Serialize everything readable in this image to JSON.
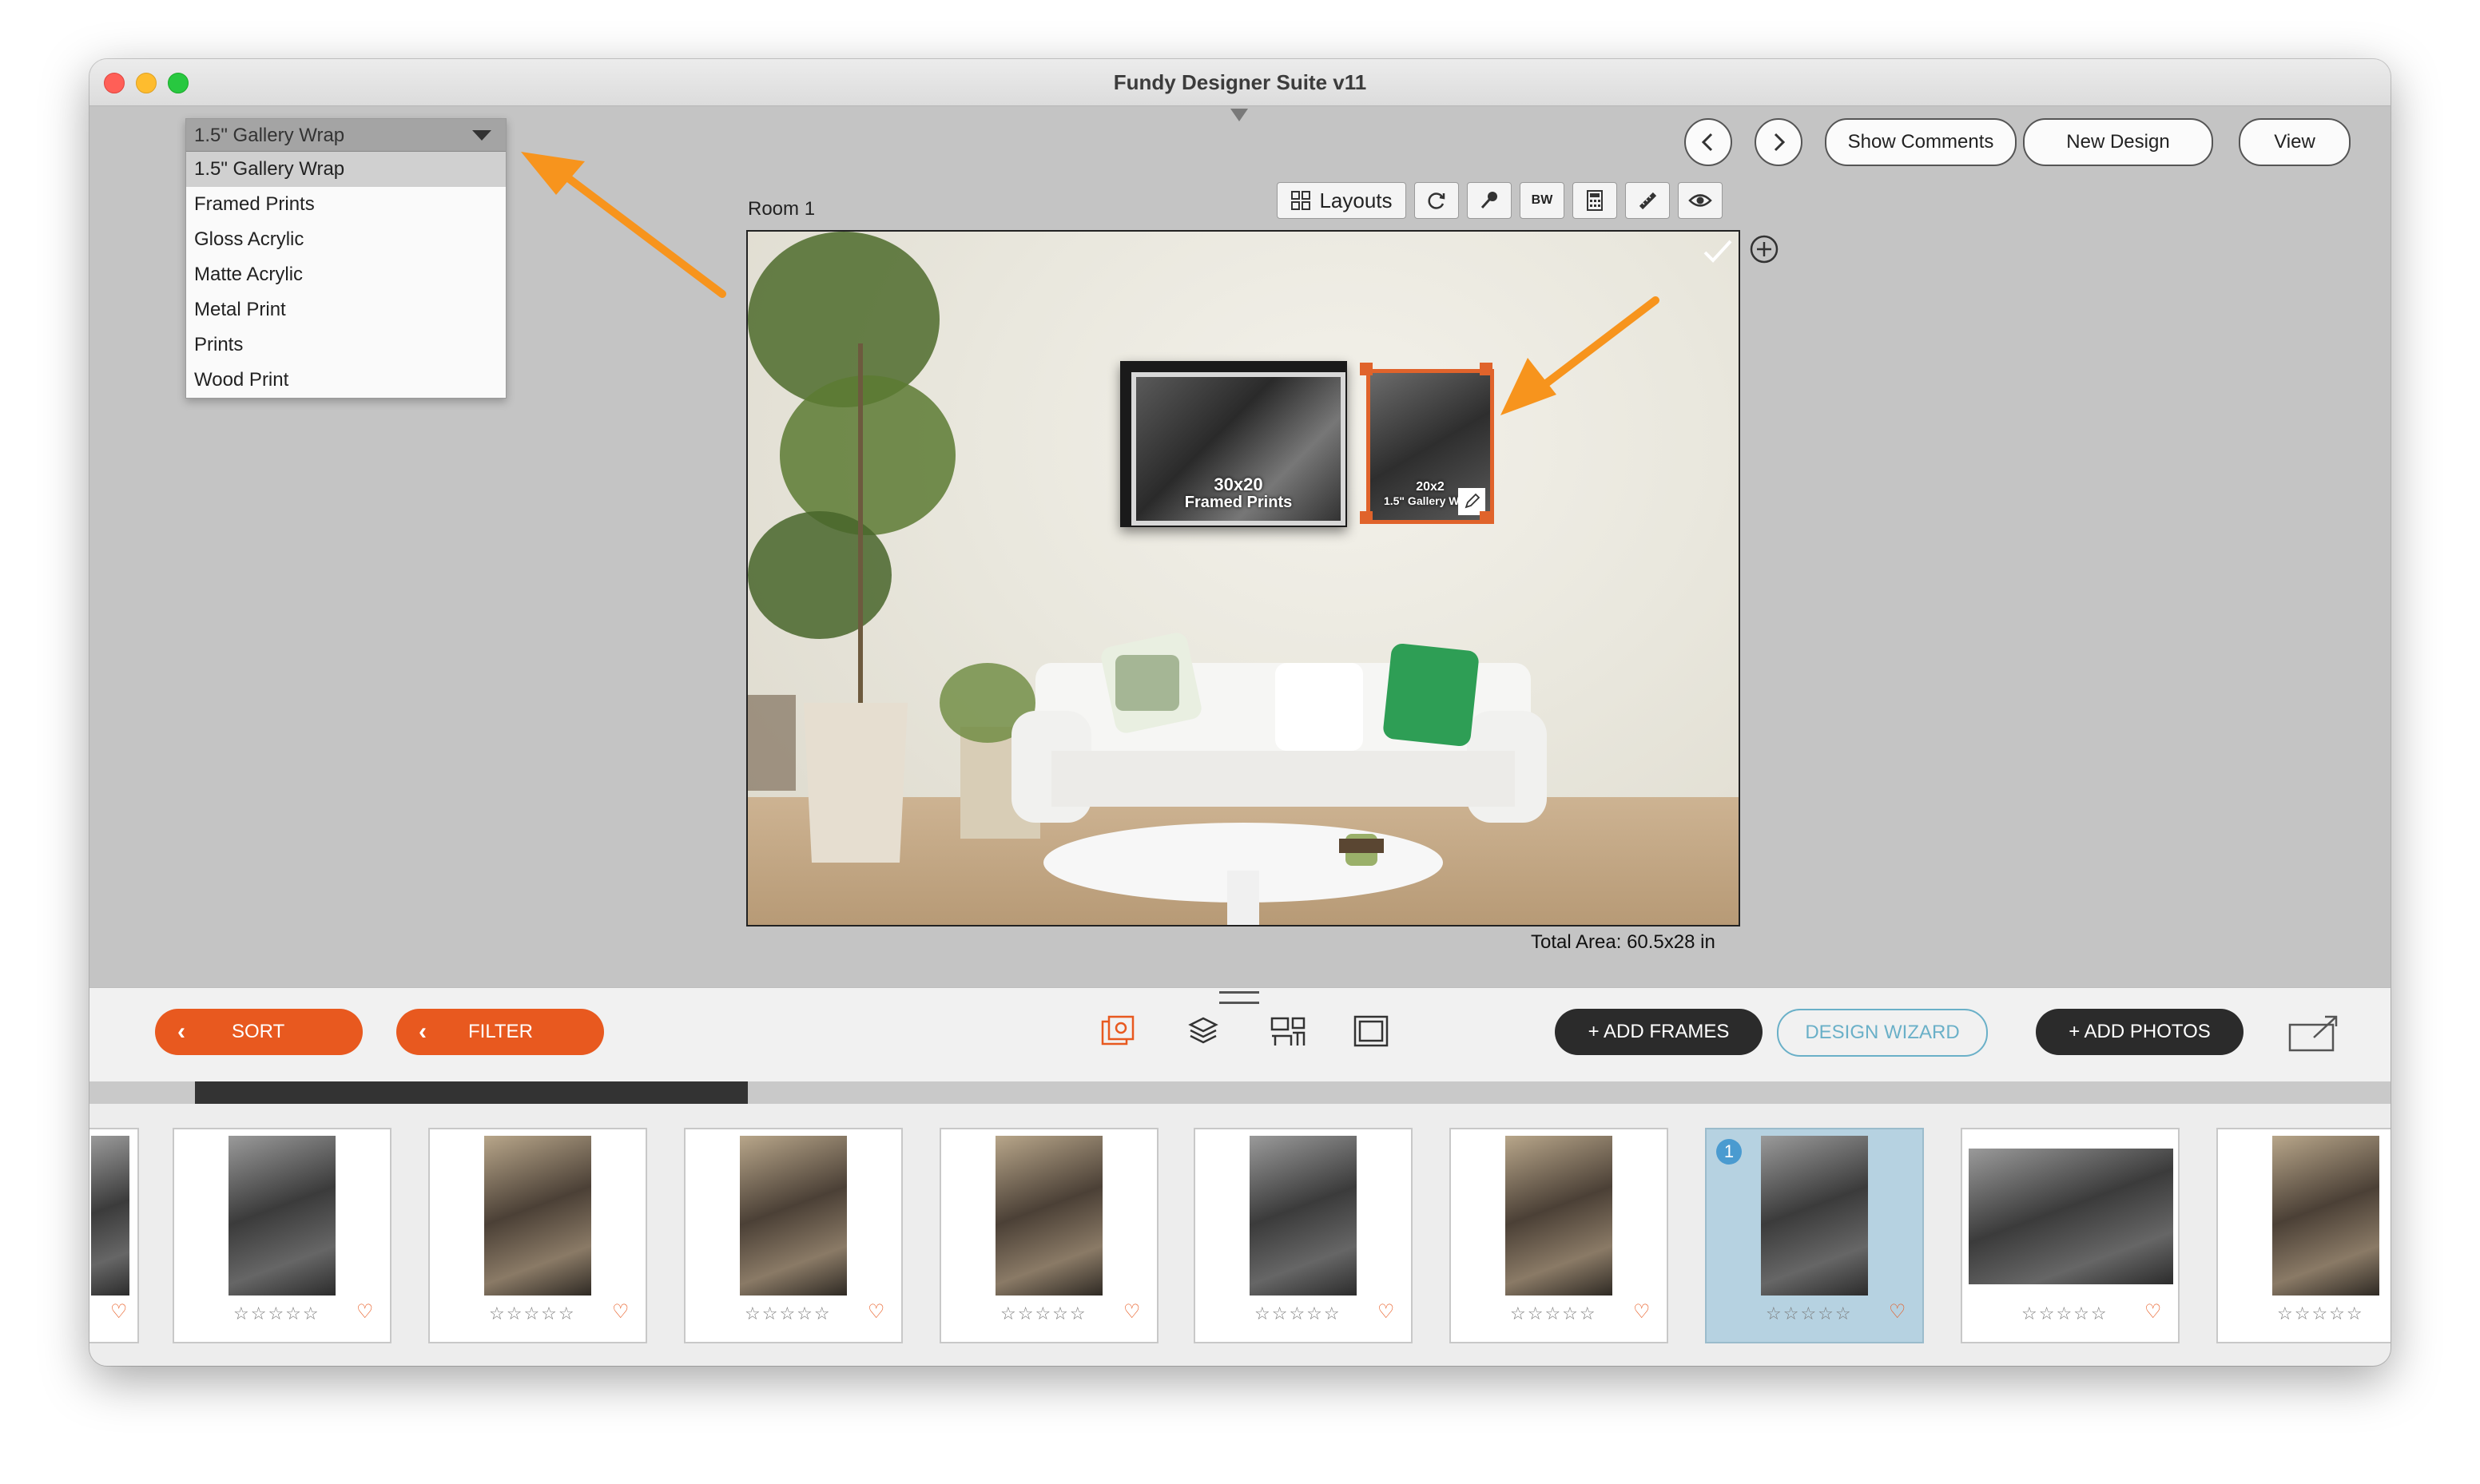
{
  "window": {
    "title": "Fundy Designer Suite v11"
  },
  "dropdown": {
    "selected": "1.5\" Gallery Wrap",
    "options": [
      "1.5\" Gallery Wrap",
      "Framed Prints",
      "Gloss Acrylic",
      "Matte Acrylic",
      "Metal Print",
      "Prints",
      "Wood Print"
    ]
  },
  "header": {
    "show_comments": "Show Comments",
    "new_design": "New Design",
    "view": "View"
  },
  "toolbar": {
    "layouts": "Layouts",
    "bw": "BW"
  },
  "room": {
    "label": "Room 1",
    "frame1": {
      "size": "30x20",
      "type": "Framed Prints"
    },
    "frame2": {
      "size": "20x2",
      "type": "1.5\" Gallery Wrap"
    },
    "total_area": "Total Area: 60.5x28 in"
  },
  "bottom": {
    "sort": "SORT",
    "filter": "FILTER",
    "add_frames": "+ ADD FRAMES",
    "design_wizard": "DESIGN WIZARD",
    "add_photos": "+ ADD PHOTOS"
  },
  "photos": [
    {
      "badge": "",
      "selected": false
    },
    {
      "badge": "",
      "selected": false
    },
    {
      "badge": "",
      "selected": false
    },
    {
      "badge": "",
      "selected": false
    },
    {
      "badge": "",
      "selected": false
    },
    {
      "badge": "",
      "selected": false
    },
    {
      "badge": "1",
      "selected": true
    },
    {
      "badge": "",
      "selected": false
    },
    {
      "badge": "",
      "selected": false
    }
  ],
  "colors": {
    "accent_orange": "#e8591f",
    "dark_button": "#2b2b2b",
    "wizard_blue": "#6ab0c8",
    "selected_card": "#b6d2e1"
  }
}
